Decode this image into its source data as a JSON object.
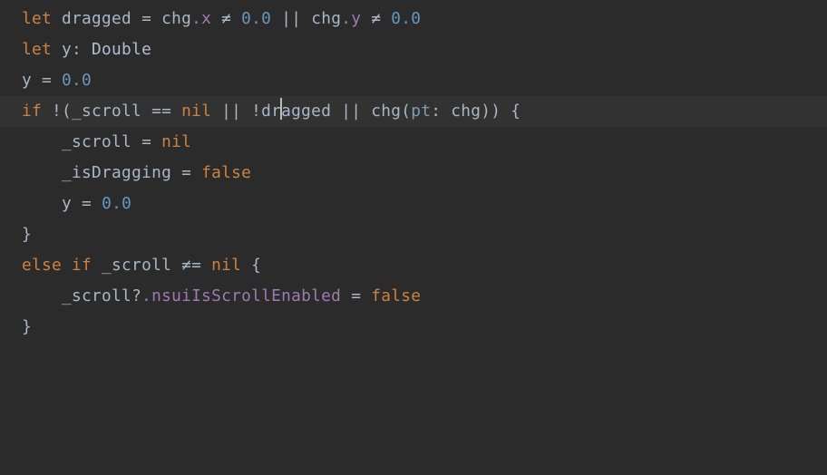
{
  "code": {
    "lines": [
      {
        "indent": 0,
        "tokens": [
          {
            "t": "let ",
            "c": "tok-kw"
          },
          {
            "t": "dragged = chg",
            "c": "tok-ident"
          },
          {
            "t": ".x",
            "c": "tok-member"
          },
          {
            "t": " ",
            "c": "tok-ident"
          },
          {
            "t": "≠",
            "c": "tok-op"
          },
          {
            "t": " ",
            "c": "tok-ident"
          },
          {
            "t": "0.0",
            "c": "tok-number"
          },
          {
            "t": " || chg",
            "c": "tok-ident"
          },
          {
            "t": ".y",
            "c": "tok-member"
          },
          {
            "t": " ",
            "c": "tok-ident"
          },
          {
            "t": "≠",
            "c": "tok-op"
          },
          {
            "t": " ",
            "c": "tok-ident"
          },
          {
            "t": "0.0",
            "c": "tok-number"
          }
        ]
      },
      {
        "indent": 0,
        "tokens": [
          {
            "t": "let ",
            "c": "tok-kw"
          },
          {
            "t": "y: ",
            "c": "tok-ident"
          },
          {
            "t": "Double",
            "c": "tok-type"
          }
        ]
      },
      {
        "indent": 0,
        "tokens": [
          {
            "t": "y = ",
            "c": "tok-ident"
          },
          {
            "t": "0.0",
            "c": "tok-number"
          }
        ]
      },
      {
        "indent": 0,
        "cursorLine": true,
        "tokens": [
          {
            "t": "if ",
            "c": "tok-kw"
          },
          {
            "t": "!(_scroll ",
            "c": "tok-ident"
          },
          {
            "t": "==",
            "c": "tok-op"
          },
          {
            "t": " ",
            "c": "tok-ident"
          },
          {
            "t": "nil",
            "c": "tok-literal"
          },
          {
            "t": " || !dr",
            "c": "tok-ident"
          },
          {
            "caret": true
          },
          {
            "t": "agged || chg(",
            "c": "tok-ident"
          },
          {
            "t": "pt",
            "c": "tok-param"
          },
          {
            "t": ": chg)) {",
            "c": "tok-ident"
          }
        ]
      },
      {
        "indent": 1,
        "tokens": [
          {
            "t": "_scroll = ",
            "c": "tok-ident"
          },
          {
            "t": "nil",
            "c": "tok-literal"
          }
        ]
      },
      {
        "indent": 1,
        "tokens": [
          {
            "t": "_isDragging = ",
            "c": "tok-ident"
          },
          {
            "t": "false",
            "c": "tok-literal"
          }
        ]
      },
      {
        "indent": 1,
        "tokens": [
          {
            "t": "y = ",
            "c": "tok-ident"
          },
          {
            "t": "0.0",
            "c": "tok-number"
          }
        ]
      },
      {
        "indent": 0,
        "tokens": [
          {
            "t": "}",
            "c": "tok-ident"
          }
        ]
      },
      {
        "indent": 0,
        "tokens": [
          {
            "t": "else if ",
            "c": "tok-kw"
          },
          {
            "t": "_scroll ",
            "c": "tok-ident"
          },
          {
            "t": "≠=",
            "c": "tok-op"
          },
          {
            "t": " ",
            "c": "tok-ident"
          },
          {
            "t": "nil",
            "c": "tok-literal"
          },
          {
            "t": " {",
            "c": "tok-ident"
          }
        ]
      },
      {
        "indent": 1,
        "tokens": [
          {
            "t": "_scroll?",
            "c": "tok-ident"
          },
          {
            "t": ".nsuiIsScrollEnabled",
            "c": "tok-member"
          },
          {
            "t": " = ",
            "c": "tok-ident"
          },
          {
            "t": "false",
            "c": "tok-literal"
          }
        ]
      },
      {
        "indent": 0,
        "tokens": [
          {
            "t": "}",
            "c": "tok-ident"
          }
        ]
      }
    ],
    "indentUnit": "    "
  }
}
